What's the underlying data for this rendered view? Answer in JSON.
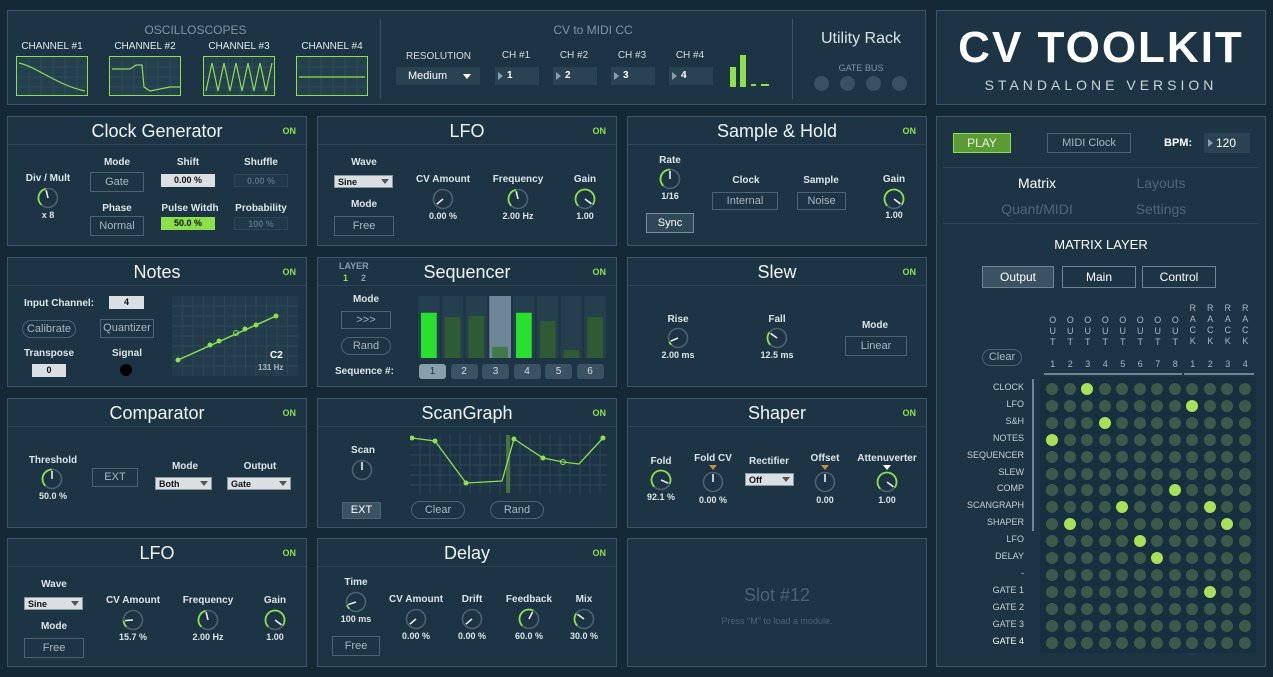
{
  "top": {
    "osc": {
      "title": "OSCILLOSCOPES",
      "channels": [
        "CHANNEL #1",
        "CHANNEL #2",
        "CHANNEL #3",
        "CHANNEL #4"
      ]
    },
    "cv": {
      "title": "CV to MIDI CC",
      "resolution_label": "RESOLUTION",
      "resolution_value": "Medium",
      "channels": [
        {
          "label": "CH #1",
          "value": "1"
        },
        {
          "label": "CH #2",
          "value": "2"
        },
        {
          "label": "CH #3",
          "value": "3"
        },
        {
          "label": "CH #4",
          "value": "4"
        }
      ]
    },
    "util": {
      "title": "Utility Rack",
      "gate_bus": "GATE BUS"
    },
    "brand": {
      "title": "CV TOOLKIT",
      "subtitle": "STANDALONE VERSION"
    }
  },
  "on": "ON",
  "clock": {
    "title": "Clock Generator",
    "div_label": "Div / Mult",
    "div_val": "x 8",
    "mode_label": "Mode",
    "mode_val": "Gate",
    "shift_label": "Shift",
    "shift_val": "0.00 %",
    "shuffle_label": "Shuffle",
    "shuffle_val": "0.00 %",
    "phase_label": "Phase",
    "phase_val": "Normal",
    "pw_label": "Pulse Witdh",
    "pw_val": "50.0 %",
    "prob_label": "Probability",
    "prob_val": "100 %"
  },
  "lfo1": {
    "title": "LFO",
    "wave_label": "Wave",
    "wave_val": "Sine",
    "mode_label": "Mode",
    "mode_val": "Free",
    "cv_label": "CV Amount",
    "cv_val": "0.00 %",
    "freq_label": "Frequency",
    "freq_val": "2.00 Hz",
    "gain_label": "Gain",
    "gain_val": "1.00"
  },
  "sh": {
    "title": "Sample & Hold",
    "rate_label": "Rate",
    "rate_val": "1/16",
    "sync": "Sync",
    "clock_label": "Clock",
    "clock_val": "Internal",
    "sample_label": "Sample",
    "sample_val": "Noise",
    "gain_label": "Gain",
    "gain_val": "1.00"
  },
  "notes": {
    "title": "Notes",
    "input_label": "Input Channel:",
    "input_val": "4",
    "calibrate": "Calibrate",
    "quantizer": "Quantizer",
    "transpose_label": "Transpose",
    "transpose_val": "0",
    "signal_label": "Signal",
    "note": "C2",
    "hz": "131 Hz"
  },
  "seq": {
    "title": "Sequencer",
    "layer_label": "LAYER",
    "layer1": "1",
    "layer2": "2",
    "mode_label": "Mode",
    "mode_val": ">>>",
    "rand": "Rand",
    "seqnum_label": "Sequence #:",
    "nums": [
      "1",
      "2",
      "3",
      "4",
      "5",
      "6"
    ],
    "bars": [
      0.73,
      0.66,
      0.68,
      0.18,
      0.73,
      0.6,
      0.13,
      0.66
    ]
  },
  "slew": {
    "title": "Slew",
    "rise_label": "Rise",
    "rise_val": "2.00 ms",
    "fall_label": "Fall",
    "fall_val": "12.5 ms",
    "mode_label": "Mode",
    "mode_val": "Linear"
  },
  "comp": {
    "title": "Comparator",
    "thresh_label": "Threshold",
    "thresh_val": "50.0 %",
    "ext": "EXT",
    "mode_label": "Mode",
    "mode_val": "Both",
    "out_label": "Output",
    "out_val": "Gate"
  },
  "scan": {
    "title": "ScanGraph",
    "scan_label": "Scan",
    "ext": "EXT",
    "clear": "Clear",
    "rand": "Rand"
  },
  "shaper": {
    "title": "Shaper",
    "fold_label": "Fold",
    "fold_val": "92.1 %",
    "foldcv_label": "Fold CV",
    "foldcv_val": "0.00 %",
    "rect_label": "Rectifier",
    "rect_val": "Off",
    "offset_label": "Offset",
    "offset_val": "0.00",
    "att_label": "Attenuverter",
    "att_val": "1.00"
  },
  "lfo2": {
    "title": "LFO",
    "wave_label": "Wave",
    "wave_val": "Sine",
    "mode_label": "Mode",
    "mode_val": "Free",
    "cv_label": "CV Amount",
    "cv_val": "15.7 %",
    "freq_label": "Frequency",
    "freq_val": "2.00 Hz",
    "gain_label": "Gain",
    "gain_val": "1.00"
  },
  "delay": {
    "title": "Delay",
    "time_label": "Time",
    "time_val": "100 ms",
    "mode_val": "Free",
    "cv_label": "CV Amount",
    "cv_val": "0.00 %",
    "drift_label": "Drift",
    "drift_val": "0.00 %",
    "fb_label": "Feedback",
    "fb_val": "60.0 %",
    "mix_label": "Mix",
    "mix_val": "30.0 %"
  },
  "slot": {
    "title": "Slot #12",
    "hint": "Press \"M\" to load a module."
  },
  "right": {
    "play": "PLAY",
    "midi_clock": "MIDI Clock",
    "bpm_label": "BPM:",
    "bpm_val": "120",
    "tabs": [
      "Matrix",
      "Layouts",
      "Quant/MIDI",
      "Settings"
    ],
    "matrix_title": "MATRIX LAYER",
    "mtabs": [
      "Output",
      "Main",
      "Control"
    ],
    "clear": "Clear",
    "cols": [
      "OUT",
      "OUT",
      "OUT",
      "OUT",
      "OUT",
      "OUT",
      "OUT",
      "OUT",
      "RACK",
      "RACK",
      "RACK",
      "RACK"
    ],
    "colnums": [
      "1",
      "2",
      "3",
      "4",
      "5",
      "6",
      "7",
      "8",
      "1",
      "2",
      "3",
      "4"
    ],
    "rows": [
      "CLOCK",
      "LFO",
      "S&H",
      "NOTES",
      "SEQUENCER",
      "SLEW",
      "COMP",
      "SCANGRAPH",
      "SHAPER",
      "LFO",
      "DELAY",
      "-",
      "GATE 1",
      "GATE 2",
      "GATE 3",
      "GATE 4"
    ],
    "active": [
      [
        0,
        2
      ],
      [
        1,
        8
      ],
      [
        2,
        3
      ],
      [
        3,
        0
      ],
      [
        6,
        7
      ],
      [
        7,
        4
      ],
      [
        7,
        9
      ],
      [
        8,
        1
      ],
      [
        8,
        10
      ],
      [
        9,
        5
      ],
      [
        10,
        6
      ],
      [
        12,
        9
      ]
    ]
  }
}
